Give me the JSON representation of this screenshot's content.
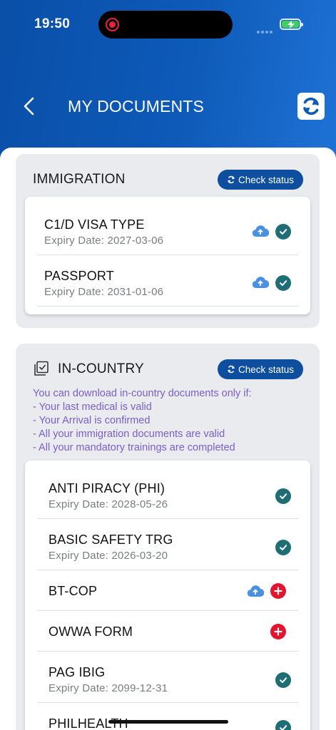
{
  "status": {
    "time": "19:50"
  },
  "header": {
    "title": "MY DOCUMENTS"
  },
  "immigration": {
    "title": "IMMIGRATION",
    "check_label": "Check status",
    "items": [
      {
        "name": "C1/D VISA TYPE",
        "expiry": "Expiry Date: 2027-03-06",
        "upload": true,
        "status": "ok"
      },
      {
        "name": "PASSPORT",
        "expiry": "Expiry Date: 2031-01-06",
        "upload": true,
        "status": "ok"
      }
    ]
  },
  "incountry": {
    "title": "IN-COUNTRY",
    "check_label": "Check status",
    "note": [
      "You can download in-country documents only if:",
      "- Your last medical is valid",
      "- Your Arrival is confirmed",
      "- All your immigration documents are valid",
      "- All your mandatory trainings are completed"
    ],
    "items": [
      {
        "name": "ANTI PIRACY (PHI)",
        "expiry": "Expiry Date: 2028-05-26",
        "upload": false,
        "status": "ok"
      },
      {
        "name": "BASIC SAFETY TRG",
        "expiry": "Expiry Date: 2026-03-20",
        "upload": false,
        "status": "ok"
      },
      {
        "name": "BT-COP",
        "expiry": "",
        "upload": true,
        "status": "add"
      },
      {
        "name": "OWWA FORM",
        "expiry": "",
        "upload": false,
        "status": "add"
      },
      {
        "name": "PAG IBIG",
        "expiry": "Expiry Date: 2099-12-31",
        "upload": false,
        "status": "ok"
      },
      {
        "name": "PHILHEALTH",
        "expiry": "",
        "upload": false,
        "status": "ok"
      }
    ]
  },
  "colors": {
    "header": "#0d5ab8",
    "ok": "#1f6e76",
    "add": "#e3142e",
    "note": "#7b5fc7",
    "button": "#0d4f9e",
    "cloud": "#4a90e2"
  },
  "icons": {
    "back": "chevron-left-icon",
    "refresh": "refresh-icon",
    "ok": "check-circle-icon",
    "add": "plus-circle-icon",
    "upload": "cloud-upload-icon"
  }
}
